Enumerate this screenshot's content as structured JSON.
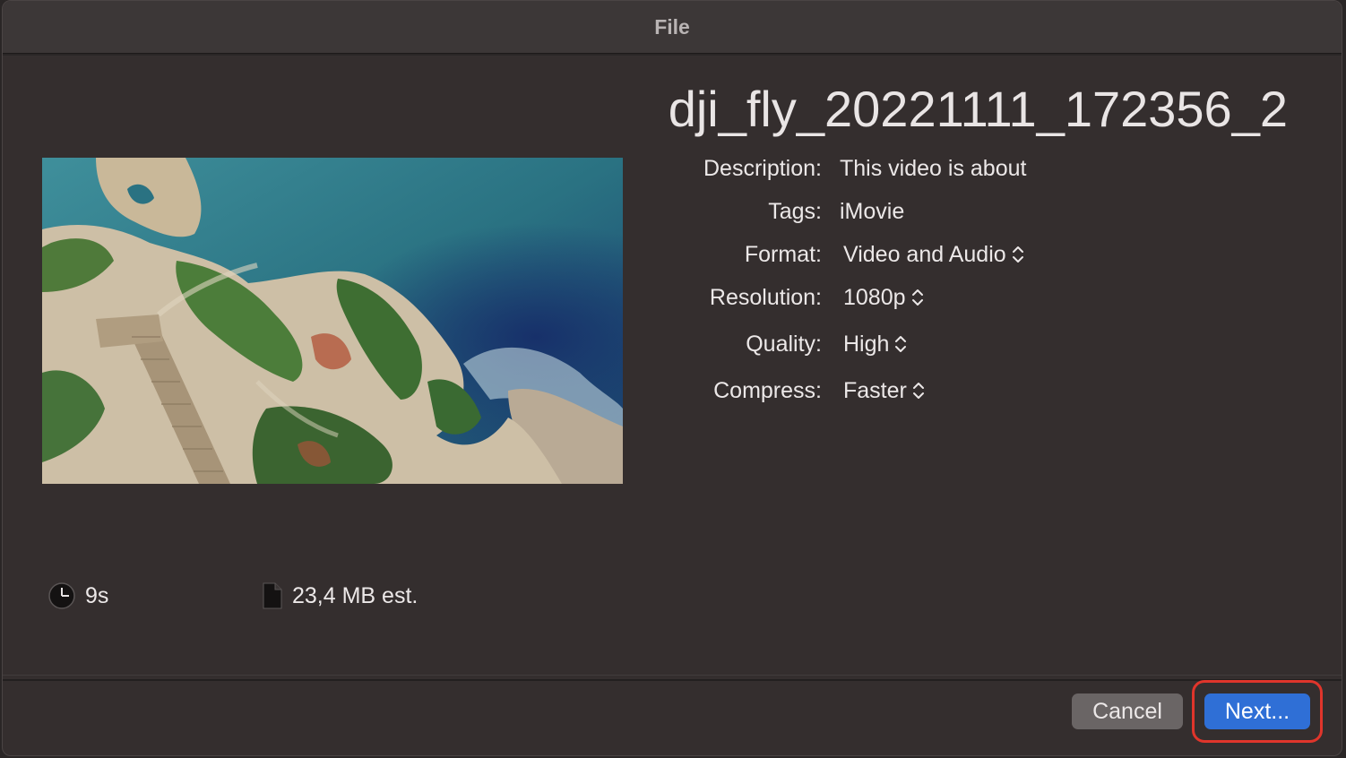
{
  "window": {
    "title": "File"
  },
  "file": {
    "name": "dji_fly_20221111_172356_2"
  },
  "fields": {
    "description": {
      "label": "Description:",
      "value": "This video is about"
    },
    "tags": {
      "label": "Tags:",
      "value": "iMovie"
    },
    "format": {
      "label": "Format:",
      "value": "Video and Audio"
    },
    "resolution": {
      "label": "Resolution:",
      "value": "1080p"
    },
    "quality": {
      "label": "Quality:",
      "value": "High"
    },
    "compress": {
      "label": "Compress:",
      "value": "Faster"
    }
  },
  "info": {
    "duration": "9s",
    "size": "23,4 MB est."
  },
  "buttons": {
    "cancel": "Cancel",
    "next": "Next..."
  },
  "icons": {
    "duration": "clock-icon",
    "size": "document-icon",
    "popup": "chevron-up-down-icon"
  },
  "colors": {
    "accent": "#2f6fd6",
    "highlight": "#e0352b"
  }
}
